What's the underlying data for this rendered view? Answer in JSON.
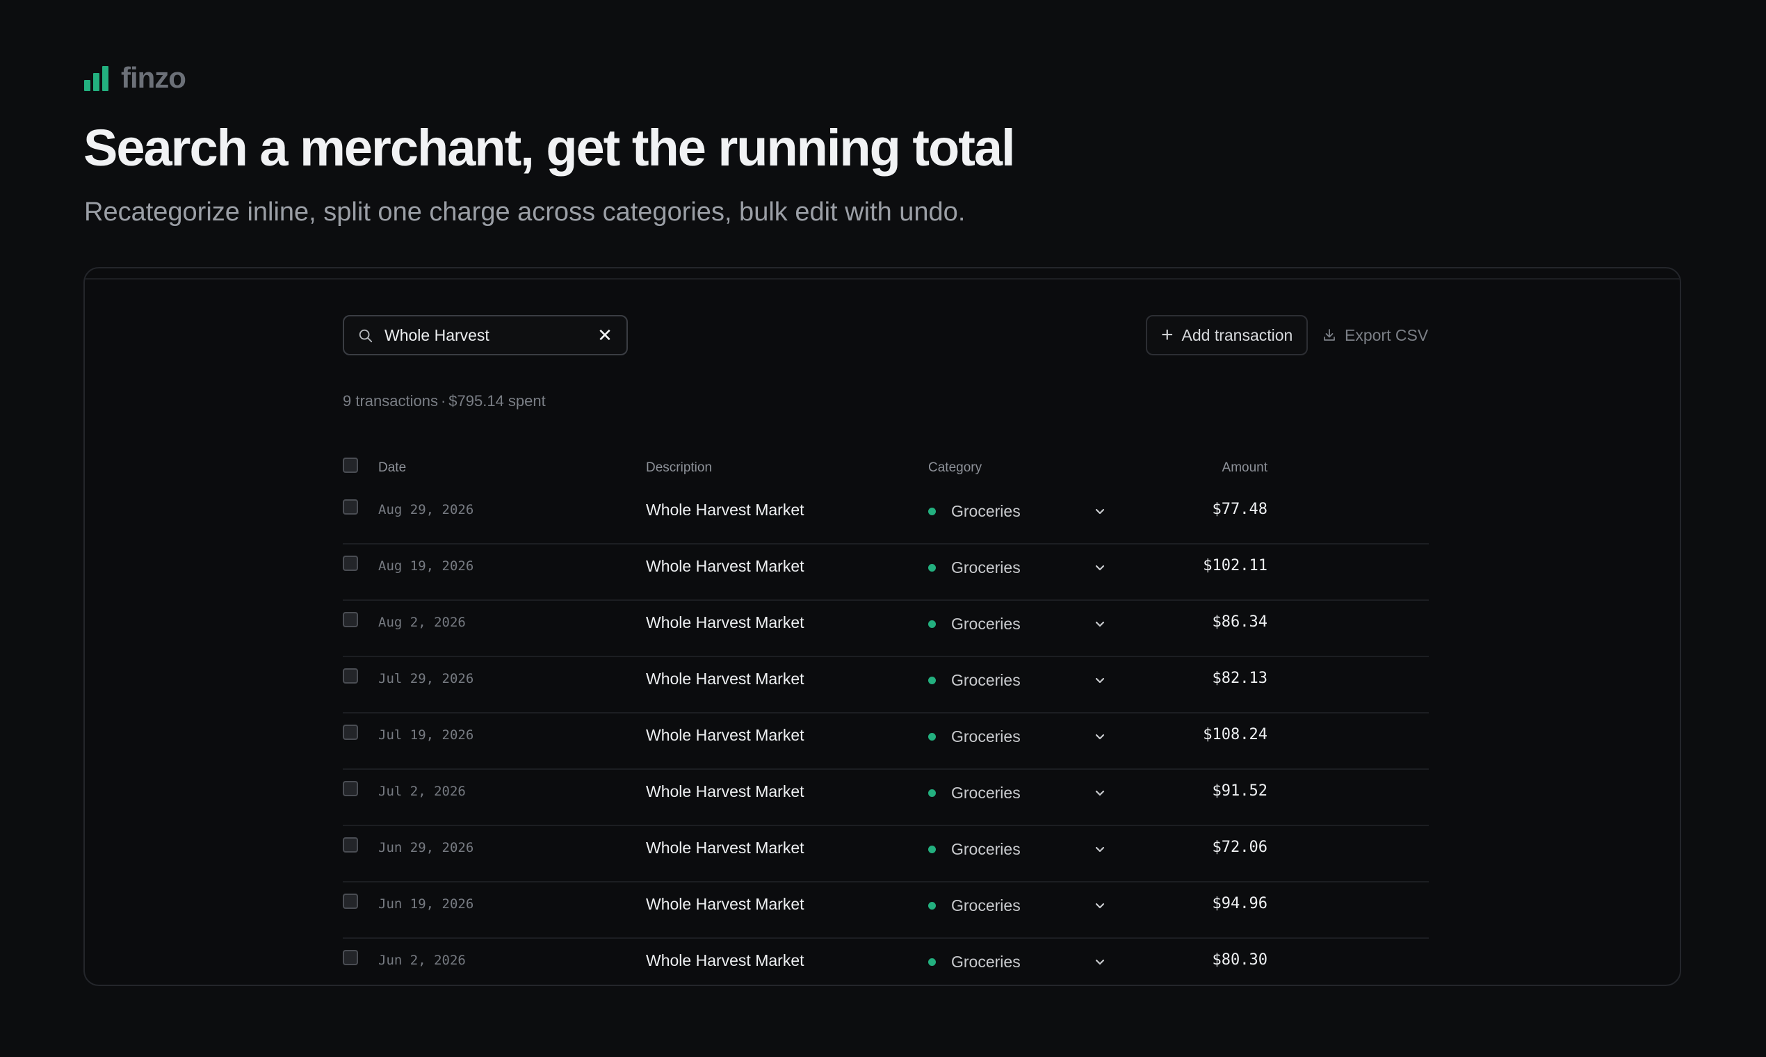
{
  "brand": {
    "name": "finzo",
    "accent": "#23b07f"
  },
  "hero": {
    "title": "Search a merchant, get the running total",
    "subtitle": "Recategorize inline, split one charge across categories, bulk edit with undo."
  },
  "toolbar": {
    "search_value": "Whole Harvest",
    "add_label": "Add transaction",
    "export_label": "Export CSV"
  },
  "summary": {
    "count": "9 transactions",
    "separator": "·",
    "spent": "$795.14 spent"
  },
  "table": {
    "headers": {
      "date": "Date",
      "description": "Description",
      "category": "Category",
      "amount": "Amount"
    },
    "rows": [
      {
        "date": "Aug 29, 2026",
        "description": "Whole Harvest Market",
        "category": "Groceries",
        "amount": "$77.48"
      },
      {
        "date": "Aug 19, 2026",
        "description": "Whole Harvest Market",
        "category": "Groceries",
        "amount": "$102.11"
      },
      {
        "date": "Aug 2, 2026",
        "description": "Whole Harvest Market",
        "category": "Groceries",
        "amount": "$86.34"
      },
      {
        "date": "Jul 29, 2026",
        "description": "Whole Harvest Market",
        "category": "Groceries",
        "amount": "$82.13"
      },
      {
        "date": "Jul 19, 2026",
        "description": "Whole Harvest Market",
        "category": "Groceries",
        "amount": "$108.24"
      },
      {
        "date": "Jul 2, 2026",
        "description": "Whole Harvest Market",
        "category": "Groceries",
        "amount": "$91.52"
      },
      {
        "date": "Jun 29, 2026",
        "description": "Whole Harvest Market",
        "category": "Groceries",
        "amount": "$72.06"
      },
      {
        "date": "Jun 19, 2026",
        "description": "Whole Harvest Market",
        "category": "Groceries",
        "amount": "$94.96"
      },
      {
        "date": "Jun 2, 2026",
        "description": "Whole Harvest Market",
        "category": "Groceries",
        "amount": "$80.30"
      }
    ]
  }
}
